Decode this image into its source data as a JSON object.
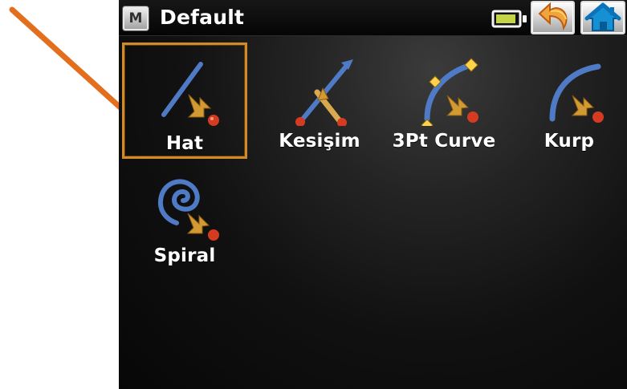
{
  "title_bar": {
    "mode_label": "M",
    "profile": "Default",
    "icons": {
      "battery": "battery-icon",
      "back": "back-arrow-icon",
      "home": "home-icon"
    }
  },
  "menu": {
    "items": [
      {
        "label": "Hat",
        "icon": "line-stakeout-icon",
        "selected": true
      },
      {
        "label": "Kesişim",
        "icon": "intersection-icon",
        "selected": false
      },
      {
        "label": "3Pt Curve",
        "icon": "three-point-curve-icon",
        "selected": false
      },
      {
        "label": "Kurp",
        "icon": "curve-icon",
        "selected": false
      },
      {
        "label": "Spiral",
        "icon": "spiral-icon",
        "selected": false
      }
    ]
  },
  "colors": {
    "screen_background": "#111111",
    "selection_border": "#d08a2a",
    "icon_blue": "#4f7bc6",
    "target_red": "#d43b20",
    "callout_arrow": "#e36f1e"
  }
}
